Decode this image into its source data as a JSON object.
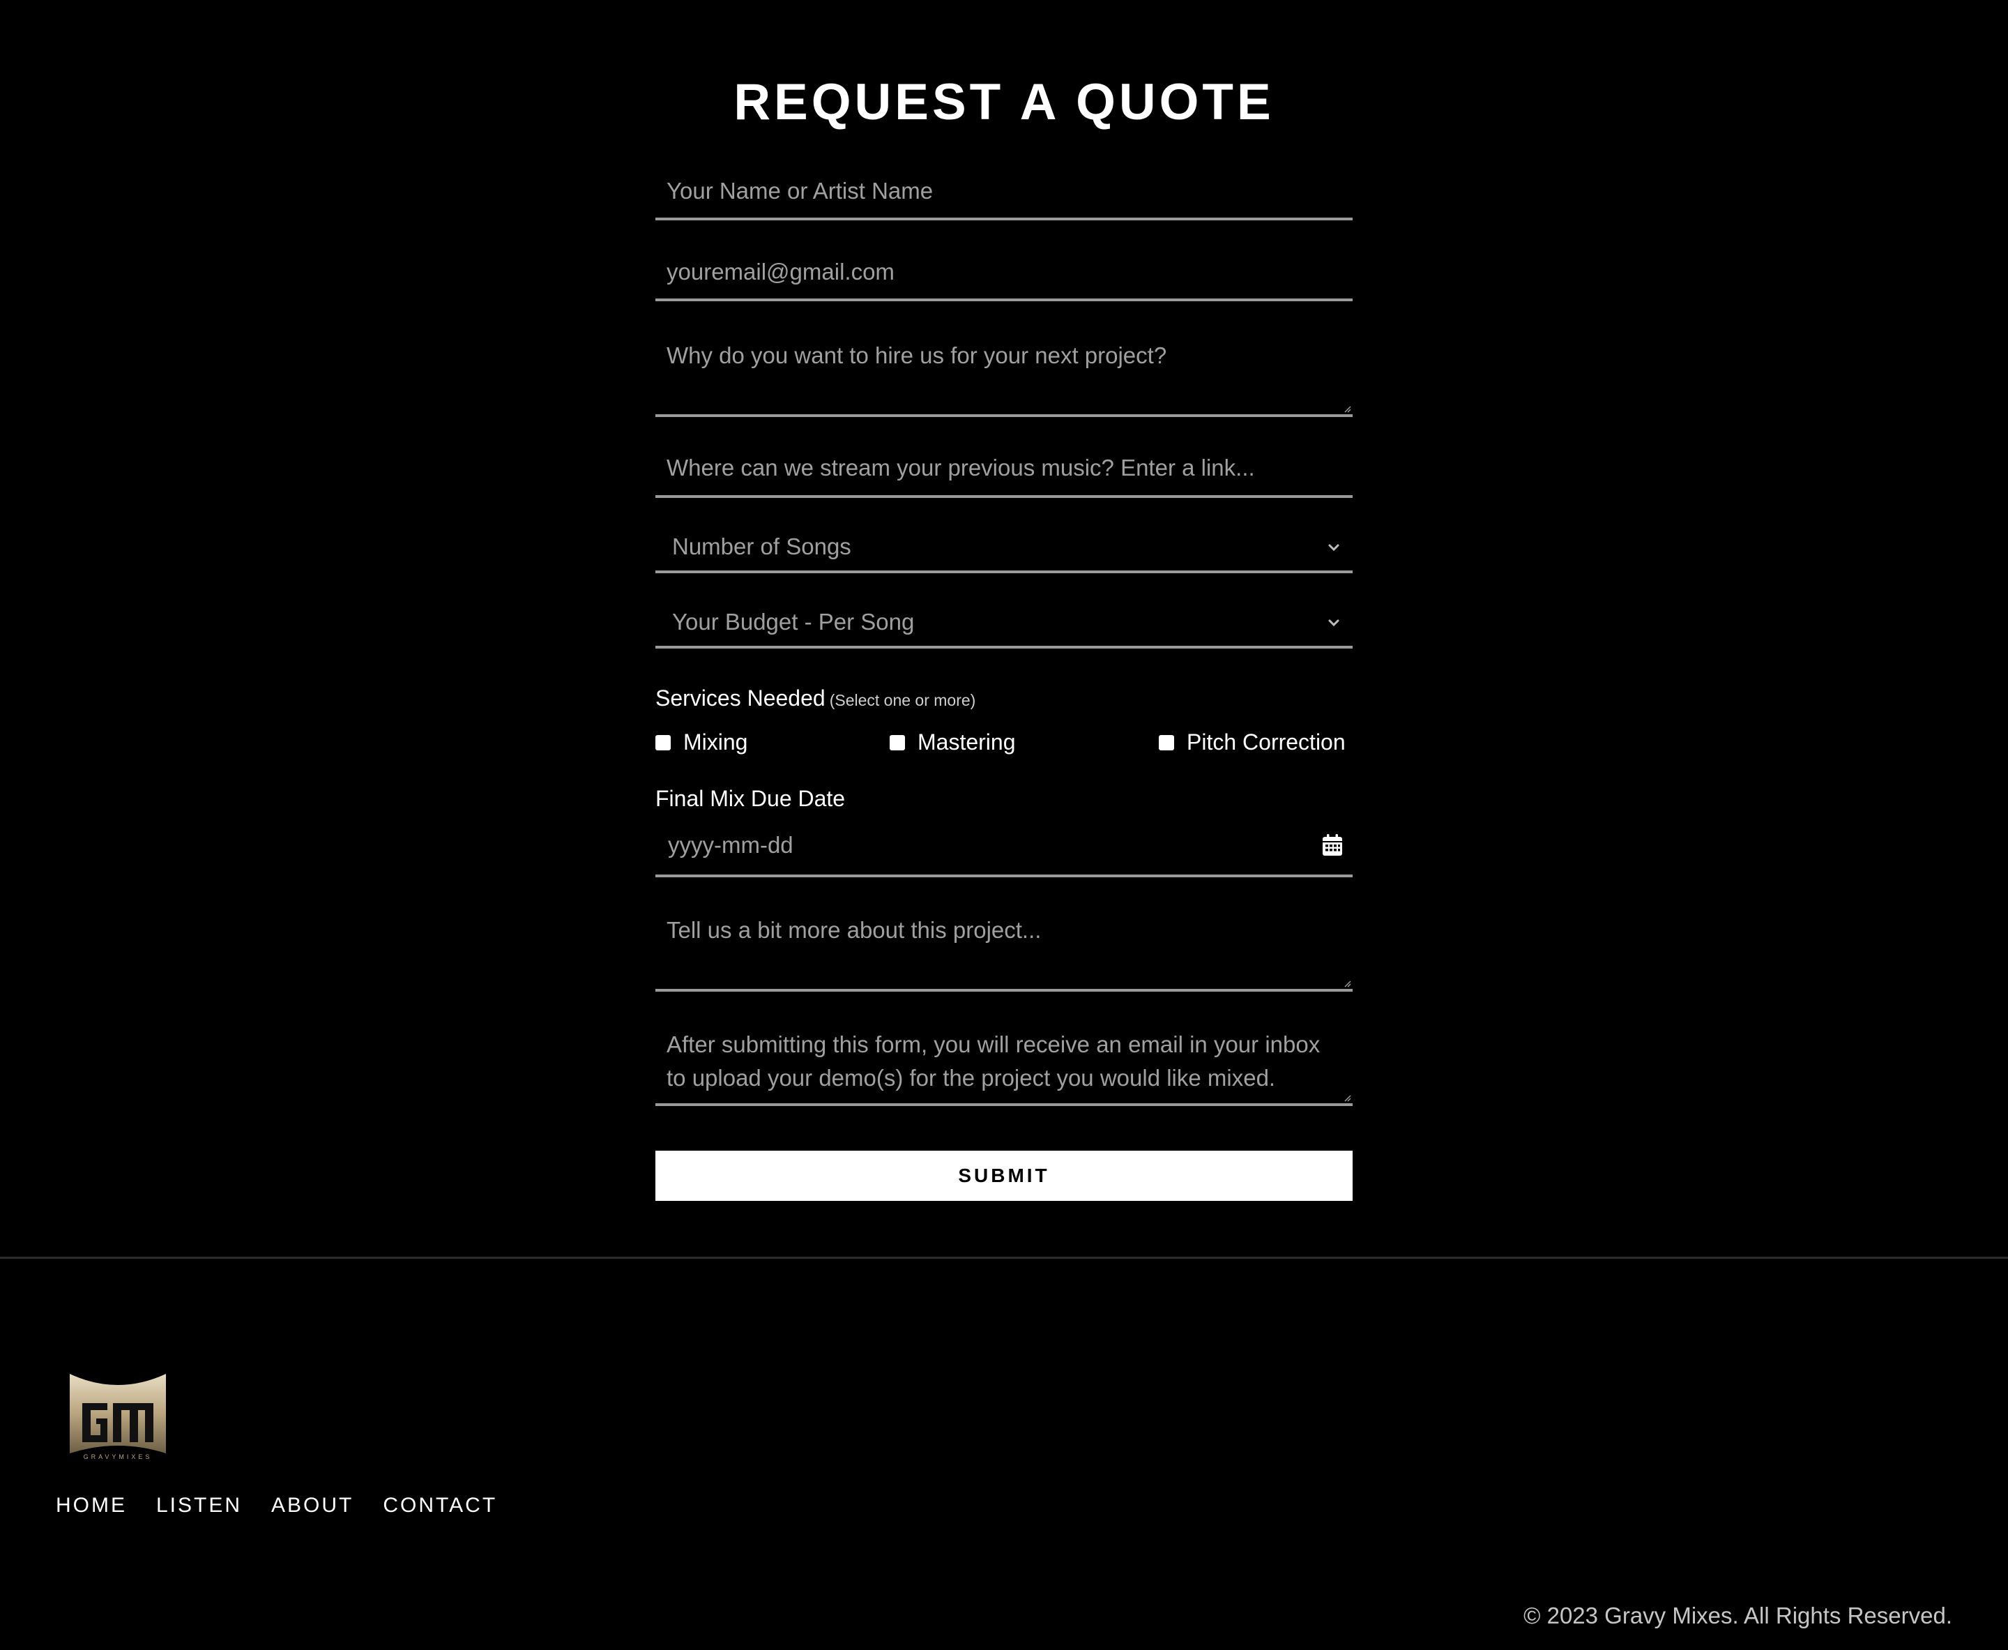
{
  "page": {
    "title": "REQUEST A QUOTE"
  },
  "form": {
    "name_placeholder": "Your Name or Artist Name",
    "email_placeholder": "youremail@gmail.com",
    "why_placeholder": "Why do you want to hire us for your next project?",
    "stream_placeholder": "Where can we stream your previous music? Enter a link...",
    "songs_select": "Number of Songs",
    "budget_select": "Your Budget - Per Song",
    "services_label": "Services Needed",
    "services_hint": "(Select one or more)",
    "services": [
      {
        "label": "Mixing",
        "checked": false
      },
      {
        "label": "Mastering",
        "checked": false
      },
      {
        "label": "Pitch Correction",
        "checked": false
      }
    ],
    "due_date_label": "Final Mix Due Date",
    "due_date_placeholder": "yyyy-mm-dd",
    "more_placeholder": "Tell us a bit more about this project...",
    "after_placeholder": "After submitting this form, you will receive an email in your inbox to upload your demo(s) for the project you would like mixed.",
    "submit_label": "SUBMIT"
  },
  "footer": {
    "nav": [
      "HOME",
      "LISTEN",
      "ABOUT",
      "CONTACT"
    ],
    "copyright": "© 2023 Gravy Mixes. All Rights Reserved.",
    "logo_icon": "gravy-mixes-logo",
    "logo_text": "GRAVYMIXES"
  },
  "colors": {
    "background": "#000000",
    "text": "#ffffff",
    "placeholder": "#a0a0a0",
    "underline": "#9a9a9a",
    "logo_gold": "#b9a57f"
  }
}
